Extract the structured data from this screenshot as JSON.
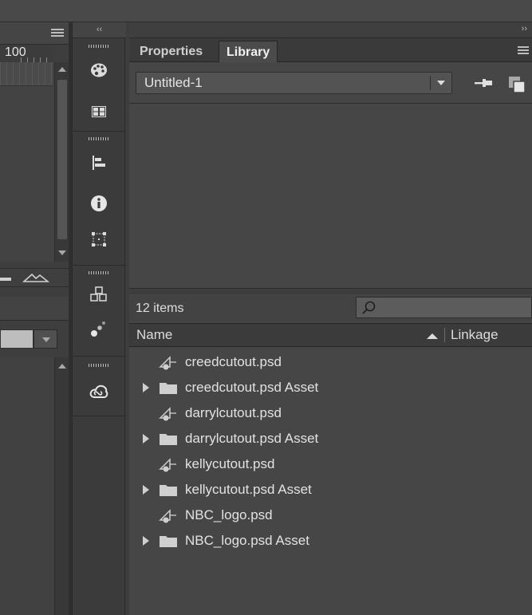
{
  "left_panel": {
    "ruler_label": "100"
  },
  "toolbar": {
    "collapse_glyph": "‹‹",
    "icons": [
      "swatches-icon",
      "grid-icon",
      "align-icon",
      "info-icon",
      "transform-icon",
      "components-icon",
      "motion-presets-icon",
      "creative-cloud-icon"
    ]
  },
  "library": {
    "expand_glyph": "››",
    "tabs": [
      {
        "label": "Properties",
        "active": false
      },
      {
        "label": "Library",
        "active": true
      }
    ],
    "document_select": "Untitled-1",
    "item_count": "12 items",
    "search": {
      "value": "",
      "placeholder": ""
    },
    "columns": {
      "name": "Name",
      "linkage": "Linkage"
    },
    "items": [
      {
        "label": "creedcutout.psd",
        "type": "bitmap",
        "expandable": false
      },
      {
        "label": "creedcutout.psd Asset",
        "type": "folder",
        "expandable": true
      },
      {
        "label": "darrylcutout.psd",
        "type": "bitmap",
        "expandable": false
      },
      {
        "label": "darrylcutout.psd Asset",
        "type": "folder",
        "expandable": true
      },
      {
        "label": "kellycutout.psd",
        "type": "bitmap",
        "expandable": false
      },
      {
        "label": "kellycutout.psd Asset",
        "type": "folder",
        "expandable": true
      },
      {
        "label": "NBC_logo.psd",
        "type": "bitmap",
        "expandable": false
      },
      {
        "label": "NBC_logo.psd Asset",
        "type": "folder",
        "expandable": true
      }
    ]
  },
  "colors": {
    "panel_bg": "#464646",
    "tab_active_bg": "#4b4b4b",
    "text": "#e2e2e2",
    "folder_icon": "#cfcfcf"
  }
}
